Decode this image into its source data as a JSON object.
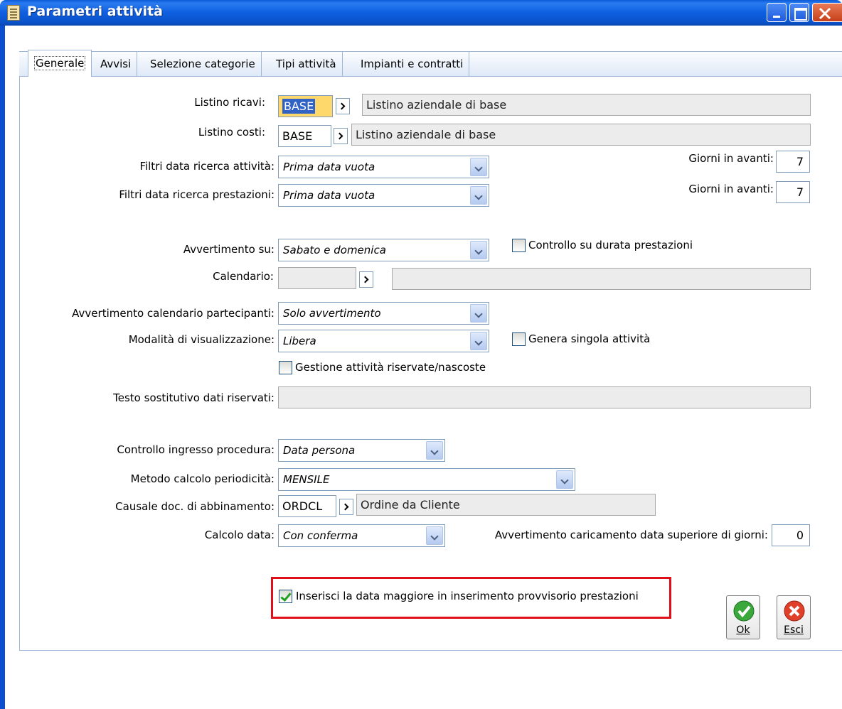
{
  "window": {
    "title": "Parametri attività"
  },
  "tabs": [
    {
      "label": "Generale"
    },
    {
      "label": "Avvisi"
    },
    {
      "label": "Selezione categorie"
    },
    {
      "label": "Tipi attività"
    },
    {
      "label": "Impianti e contratti"
    }
  ],
  "form": {
    "listino_ricavi": {
      "label": "Listino ricavi:",
      "code": "BASE",
      "desc": "Listino aziendale di base"
    },
    "listino_costi": {
      "label": "Listino costi:",
      "code": "BASE",
      "desc": "Listino aziendale di base"
    },
    "filtri_attivita": {
      "label": "Filtri data ricerca attività:",
      "value": "Prima data vuota"
    },
    "filtri_prestazioni": {
      "label": "Filtri data ricerca prestazioni:",
      "value": "Prima data vuota"
    },
    "giorni_avanti_1": {
      "label": "Giorni in avanti:",
      "value": "7"
    },
    "giorni_avanti_2": {
      "label": "Giorni in avanti:",
      "value": "7"
    },
    "avvertimento_su": {
      "label": "Avvertimento su:",
      "value": "Sabato e domenica"
    },
    "controllo_durata": {
      "label": "Controllo su durata prestazioni",
      "checked": false
    },
    "calendario": {
      "label": "Calendario:",
      "code": "",
      "desc": ""
    },
    "avv_cal_partecipanti": {
      "label": "Avvertimento calendario partecipanti:",
      "value": "Solo avvertimento"
    },
    "modalita_visualizzazione": {
      "label": "Modalità di visualizzazione:",
      "value": "Libera"
    },
    "genera_singola": {
      "label": "Genera singola attività",
      "checked": false
    },
    "gestione_riservate": {
      "label": "Gestione attività riservate/nascoste",
      "checked": false
    },
    "testo_sostitutivo": {
      "label": "Testo sostitutivo dati riservati:",
      "value": ""
    },
    "controllo_ingresso": {
      "label": "Controllo ingresso procedura:",
      "value": "Data persona"
    },
    "metodo_periodicita": {
      "label": "Metodo calcolo periodicità:",
      "value": "MENSILE"
    },
    "causale_doc": {
      "label": "Causale doc. di abbinamento:",
      "code": "ORDCL",
      "desc": "Ordine da Cliente"
    },
    "calcolo_data": {
      "label": "Calcolo data:",
      "value": "Con conferma"
    },
    "avv_caricamento": {
      "label": "Avvertimento caricamento data superiore di giorni:",
      "value": "0"
    },
    "inserisci_data": {
      "label": "Inserisci la data maggiore in inserimento provvisorio prestazioni",
      "checked": true
    }
  },
  "buttons": {
    "ok": "Ok",
    "esci": "Esci"
  },
  "colors": {
    "highlight": "#e0101a",
    "titlebar": "#0a5bd6"
  }
}
